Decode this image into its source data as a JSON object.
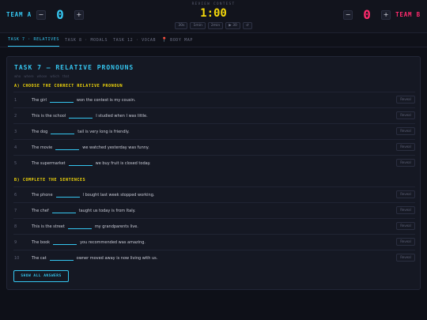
{
  "header": {
    "team_a": {
      "name": "TEAM A",
      "score": "0",
      "minus": "−",
      "plus": "+"
    },
    "team_b": {
      "name": "TEAM B",
      "score": "0",
      "minus": "−",
      "plus": "+"
    },
    "timer_label": "REVIEW CONTEST",
    "timer": "1:00",
    "timer_controls": [
      "30s",
      "1min",
      "2min",
      "▶ 30",
      "↺"
    ]
  },
  "tabs": [
    {
      "label": "TASK 7 · RELATIVES",
      "active": true
    },
    {
      "label": "TASK 8 · MODALS",
      "active": false
    },
    {
      "label": "TASK 12 · VOCAB",
      "active": false
    },
    {
      "label": "BODY MAP",
      "active": false,
      "icon": "pin-icon"
    }
  ],
  "card": {
    "title": "TASK 7 — RELATIVE PRONOUNS",
    "pronouns": [
      "who",
      "where",
      "whose",
      "which",
      "that"
    ],
    "section_a": "A) CHOOSE THE CORRECT RELATIVE PRONOUN",
    "section_b": "B) COMPLETE THE SENTENCES",
    "reveal_label": "Reveal",
    "show_all": "SHOW ALL ANSWERS",
    "rows": [
      {
        "num": "1",
        "before": "The girl",
        "after": "won the contest is my cousin."
      },
      {
        "num": "2",
        "before": "This is the school",
        "after": "I studied when I was little."
      },
      {
        "num": "3",
        "before": "The dog",
        "after": "tail is very long is friendly."
      },
      {
        "num": "4",
        "before": "The movie",
        "after": "we watched yesterday was funny."
      },
      {
        "num": "5",
        "before": "The supermarket",
        "after": "we buy fruit is closed today."
      },
      {
        "num": "6",
        "before": "The phone",
        "after": "I bought last week stopped working."
      },
      {
        "num": "7",
        "before": "The chef",
        "after": "taught us today is from Italy."
      },
      {
        "num": "8",
        "before": "This is the street",
        "after": "my grandparents live."
      },
      {
        "num": "9",
        "before": "The book",
        "after": "you recommended was amazing."
      },
      {
        "num": "10",
        "before": "The cat",
        "after": "owner moved away is now living with us."
      }
    ]
  }
}
